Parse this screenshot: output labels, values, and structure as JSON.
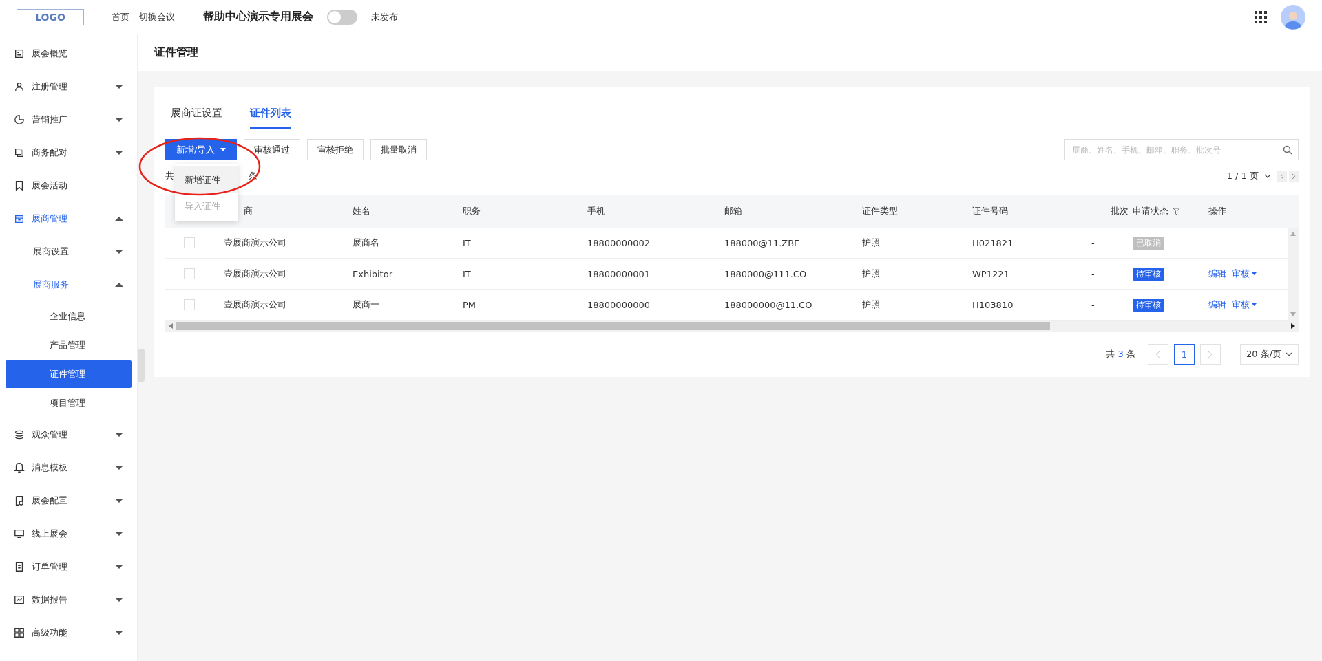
{
  "header": {
    "logo": "LOGO",
    "nav": [
      "首页",
      "切换会议"
    ],
    "event_title": "帮助中心演示专用展会",
    "published": false,
    "publish_label": "未发布"
  },
  "sidebar": {
    "items": [
      {
        "label": "展会概览",
        "selected": false
      },
      {
        "label": "注册管理",
        "selected": false,
        "expanded": false
      },
      {
        "label": "营销推广",
        "selected": false,
        "expanded": false
      },
      {
        "label": "商务配对",
        "selected": false,
        "expanded": false
      },
      {
        "label": "展会活动",
        "selected": false
      },
      {
        "label": "展商管理",
        "selected": true,
        "expanded": true,
        "children": [
          {
            "label": "展商设置",
            "selected": false,
            "expanded": false
          },
          {
            "label": "展商服务",
            "selected": true,
            "expanded": true,
            "children": [
              {
                "label": "企业信息",
                "selected": false
              },
              {
                "label": "产品管理",
                "selected": false
              },
              {
                "label": "证件管理",
                "selected": true
              },
              {
                "label": "项目管理",
                "selected": false
              }
            ]
          }
        ]
      },
      {
        "label": "观众管理",
        "selected": false,
        "expanded": false
      },
      {
        "label": "消息模板",
        "selected": false,
        "expanded": false
      },
      {
        "label": "展会配置",
        "selected": false,
        "expanded": false
      },
      {
        "label": "线上展会",
        "selected": false,
        "expanded": false
      },
      {
        "label": "订单管理",
        "selected": false,
        "expanded": false
      },
      {
        "label": "数据报告",
        "selected": false,
        "expanded": false
      },
      {
        "label": "高级功能",
        "selected": false,
        "expanded": false
      }
    ]
  },
  "page_title": "证件管理",
  "tabs": [
    {
      "label": "展商证设置",
      "selected": false
    },
    {
      "label": "证件列表",
      "selected": true
    }
  ],
  "toolbar": {
    "primary": "新增/导入",
    "buttons": [
      "审核通过",
      "审核拒绝",
      "批量取消"
    ],
    "search_placeholder": "展商、姓名、手机、邮箱、职务、批次号"
  },
  "dropdown": {
    "items": [
      {
        "label": "新增证件",
        "disabled": false,
        "hovered": true
      },
      {
        "label": "导入证件",
        "disabled": true,
        "hovered": false
      }
    ]
  },
  "total_left": "共",
  "total_right": "条",
  "page_indicator": "1 / 1 页",
  "table": {
    "columns": [
      "商",
      "姓名",
      "职务",
      "手机",
      "邮箱",
      "证件类型",
      "证件号码",
      "批次",
      "申请状态",
      "操作"
    ],
    "rows": [
      {
        "checked": false,
        "cells": [
          "壹展商演示公司",
          "展商名",
          "IT",
          "18800000002",
          "188000@11.ZBE",
          "护照",
          "H021821",
          "-"
        ],
        "status": {
          "label": "已取消",
          "kind": "cancelled"
        }
      },
      {
        "checked": false,
        "cells": [
          "壹展商演示公司",
          "Exhibitor",
          "IT",
          "18800000001",
          "1880000@111.CO",
          "护照",
          "WP1221",
          "-"
        ],
        "status": {
          "label": "待审核",
          "kind": "pending"
        },
        "actions": [
          "编辑",
          "审核"
        ]
      },
      {
        "checked": false,
        "cells": [
          "壹展商演示公司",
          "展商一",
          "PM",
          "18800000000",
          "188000000@11.CO",
          "护照",
          "H103810",
          "-"
        ],
        "status": {
          "label": "待审核",
          "kind": "pending"
        },
        "actions": [
          "编辑",
          "审核"
        ]
      }
    ]
  },
  "pagination": {
    "total_prefix": "共",
    "total": "3",
    "total_suffix": "条",
    "pages": [
      {
        "label": "1",
        "selected": true
      }
    ],
    "page_size": "20 条/页"
  }
}
